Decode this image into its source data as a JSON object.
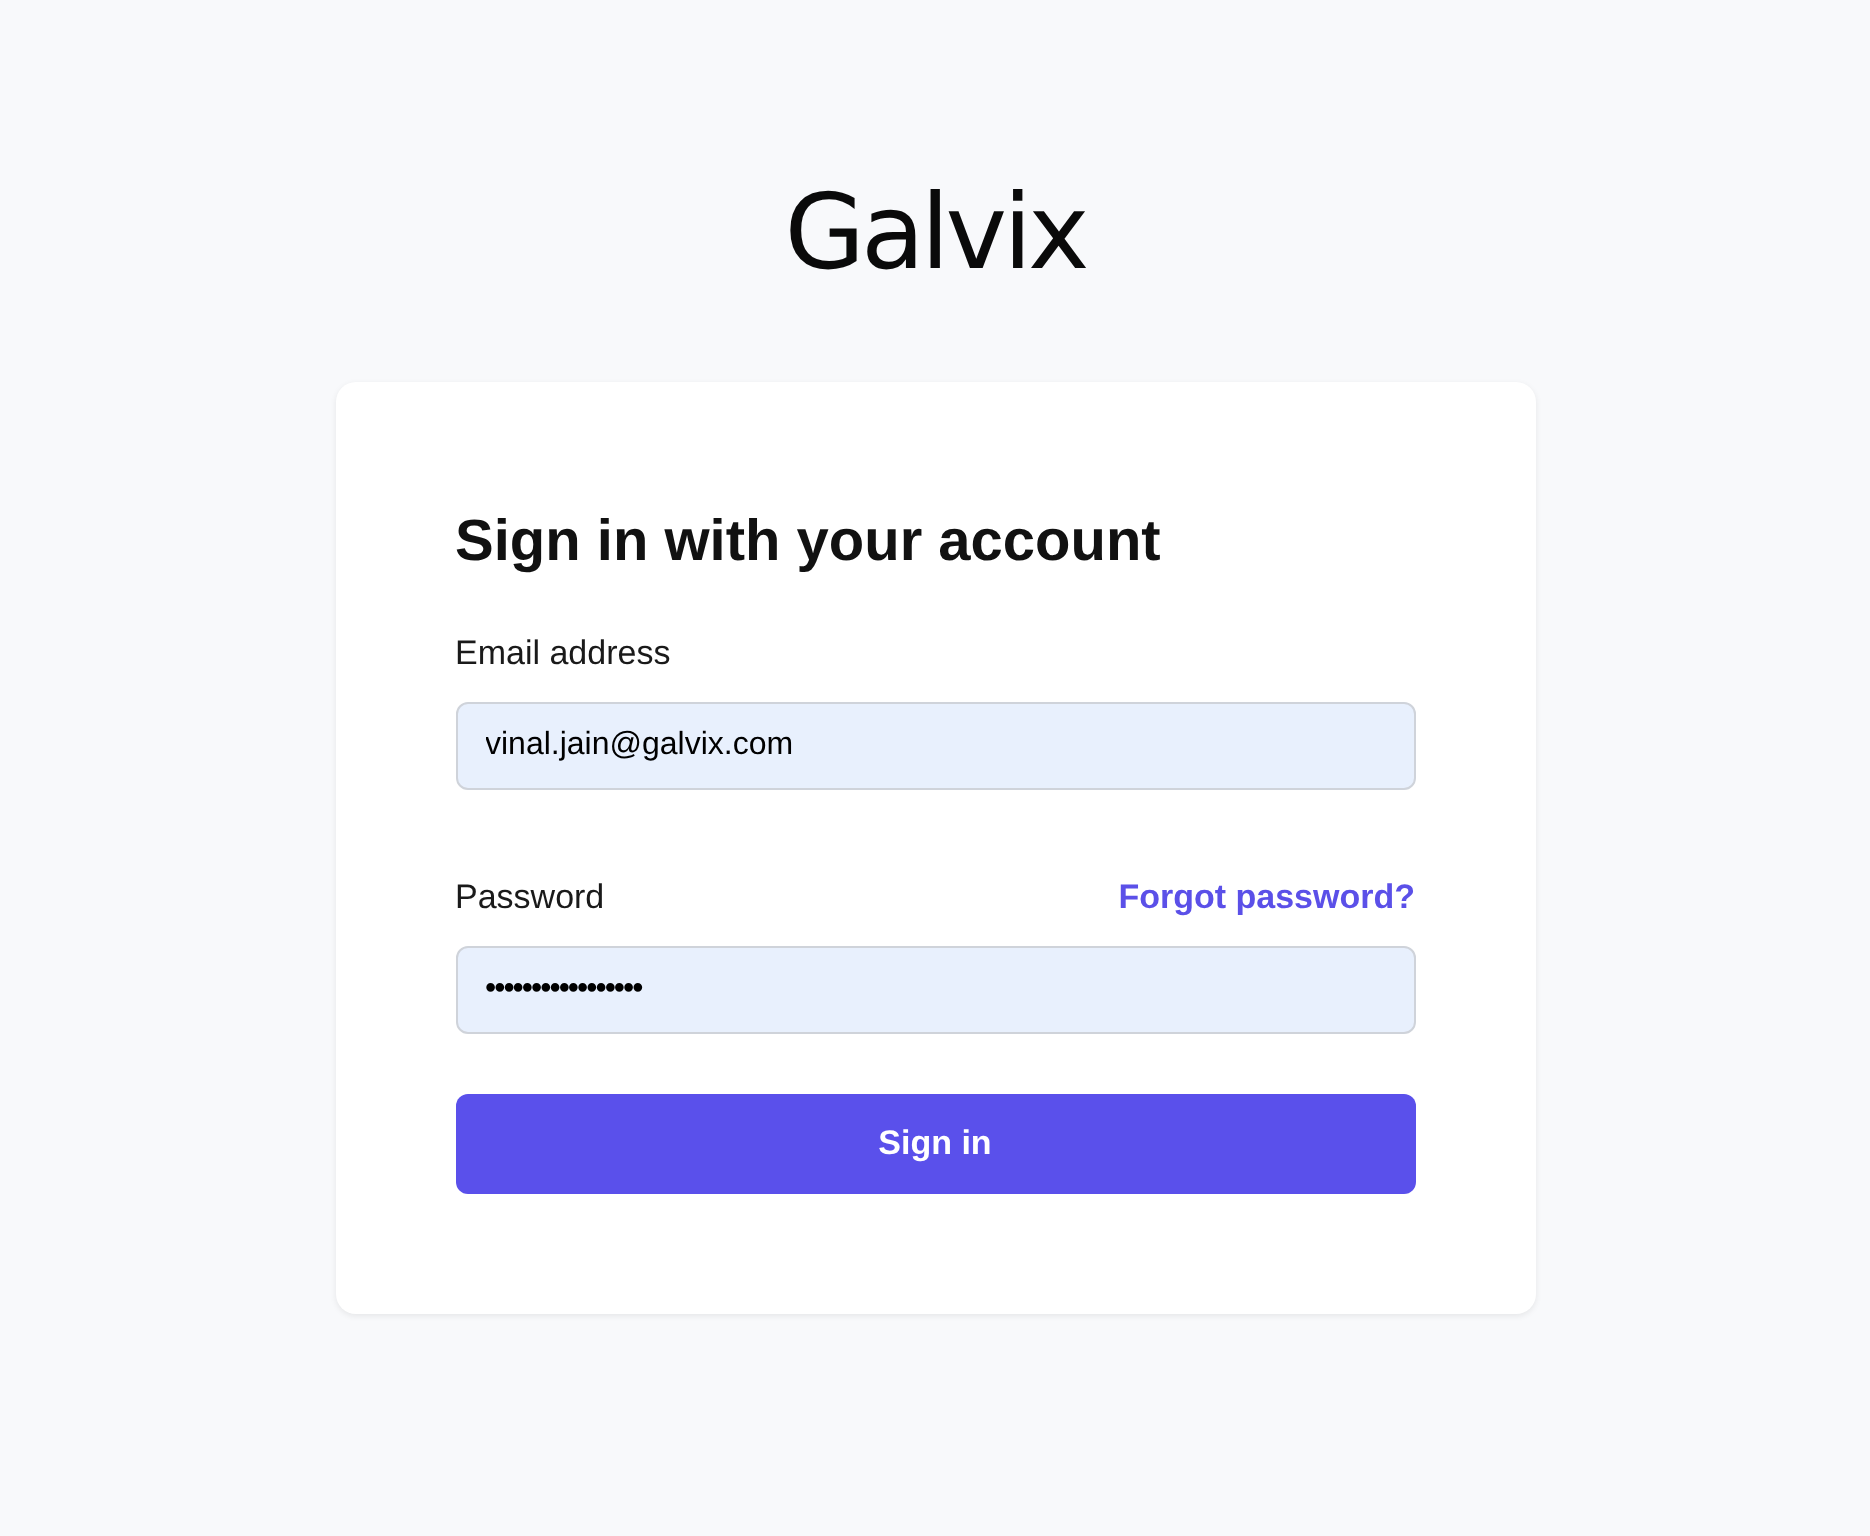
{
  "logo": "Galvix",
  "title": "Sign in with your account",
  "email": {
    "label": "Email address",
    "value": "vinal.jain@galvix.com"
  },
  "password": {
    "label": "Password",
    "value": "•••••••••••••••••",
    "forgot_link": "Forgot password?"
  },
  "submit": "Sign in"
}
